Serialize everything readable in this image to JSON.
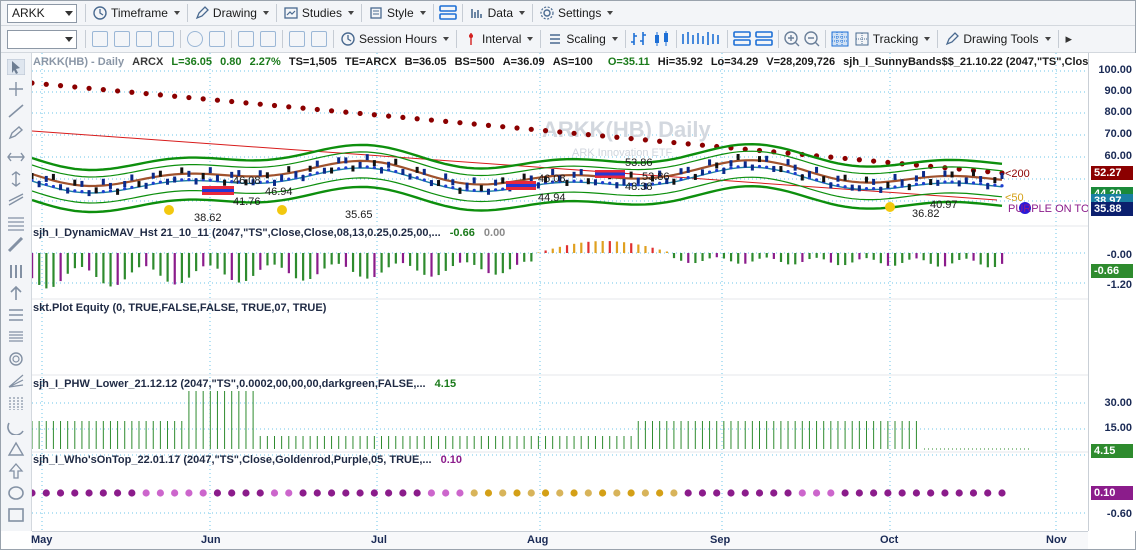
{
  "toolbar": {
    "symbol": "ARKK",
    "timeframe": "Timeframe",
    "drawing": "Drawing",
    "studies": "Studies",
    "style": "Style",
    "data": "Data",
    "settings": "Settings",
    "session_hours": "Session Hours",
    "interval": "Interval",
    "scaling": "Scaling",
    "tracking": "Tracking",
    "drawing_tools": "Drawing Tools"
  },
  "header": {
    "symbol": "ARKK(HB) - Daily",
    "exchange": "ARCX",
    "last": "L=36.05",
    "change": "0.80",
    "change_pct": "2.27%",
    "ts": "TS=1,505",
    "te": "TE=ARCX",
    "bid": "B=36.05",
    "bs": "BS=500",
    "ask": "A=36.09",
    "as": "AS=100",
    "open": "O=35.11",
    "high": "Hi=35.92",
    "low": "Lo=34.29",
    "volume": "V=28,209,726",
    "study1": "sjh_I_SunnyBands$$_21.10.22 (2047,\"TS\",Close,Close..."
  },
  "watermark": {
    "title": "ARKK(HB) Daily",
    "subtitle": "ARK Innovation ETF"
  },
  "price_annotations": {
    "a1": "38.62",
    "a2": "46.08",
    "a3": "41.76",
    "a4": "46.94",
    "a5": "35.65",
    "a6": "46.08",
    "a7": "44.94",
    "a8": "53.86",
    "a9": "53.86",
    "a10": "48.38",
    "a11": "36.82",
    "a12": "40.97",
    "ma200": "<200",
    "ma50": "<50",
    "purple_text": "PURPLE ON TO"
  },
  "panels": {
    "dynamicmav": {
      "name": "sjh_I_DynamicMAV_Hst 21_10_11 (2047,\"TS\",Close,Close,08,13,0.25,0.25,00,...",
      "v1": "-0.66",
      "v2": "0.00"
    },
    "equity": {
      "name": "skt.Plot Equity (0, TRUE,FALSE,FALSE, TRUE,07, TRUE)"
    },
    "phw": {
      "name": "sjh_I_PHW_Lower_21.12.12 (2047,\"TS\",0.0002,00,00,00,darkgreen,FALSE,...",
      "v1": "4.15"
    },
    "whosontop": {
      "name": "sjh_I_Who'sOnTop_22.01.17 (2047,\"TS\",Close,Goldenrod,Purple,05, TRUE,...",
      "v1": "0.10"
    }
  },
  "yaxis": {
    "price_ticks": [
      "100.00",
      "90.00",
      "80.00",
      "70.00",
      "60.00",
      "50.00",
      "40.00"
    ],
    "flag_200": "52.27",
    "flag_hidden1": "44.20",
    "flag_hidden2": "38.97",
    "flag_last": "35.88",
    "mav_ticks": [
      "-0.00",
      "-1.20"
    ],
    "mav_flag": "-0.66",
    "phw_ticks": [
      "30.00",
      "15.00",
      "-0.00"
    ],
    "phw_flag": "4.15",
    "wot_flag": "0.10",
    "wot_tick": "-0.60"
  },
  "xaxis": {
    "months": [
      "May",
      "Jun",
      "Jul",
      "Aug",
      "Sep",
      "Oct",
      "Nov"
    ]
  },
  "colors": {
    "ma200": "#8b0000",
    "upper_band": "#0d8f0d",
    "lower_band": "#0d8f0d",
    "mid_band": "#a0522d",
    "blue_dots": "#1f3fd0",
    "trend": "#d81b1b",
    "gold": "#f2c80f",
    "histogram_green": "#2e8b2e",
    "histogram_purple": "#8b1c8b",
    "phw_green": "#2e8b2e",
    "wot_purple": "#8b1c8b",
    "wot_gold": "#d4a017"
  }
}
